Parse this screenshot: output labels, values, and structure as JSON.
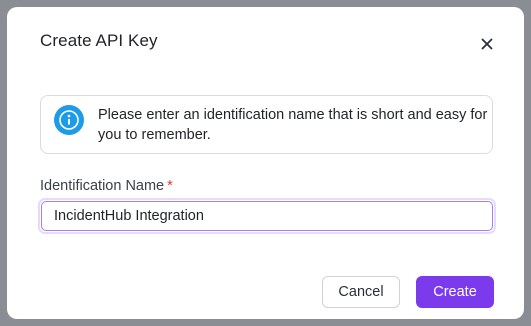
{
  "dialog": {
    "title": "Create API Key",
    "close_icon": "close-icon"
  },
  "info": {
    "icon": "info-icon",
    "message": "Please enter an identification name that is short and easy for you to remember."
  },
  "form": {
    "label": "Identification Name",
    "required_mark": "*",
    "value": "IncidentHub Integration"
  },
  "actions": {
    "cancel_label": "Cancel",
    "create_label": "Create"
  },
  "colors": {
    "accent": "#7c3aed",
    "info_icon": "#1e9be8",
    "required": "#e03a3a"
  }
}
